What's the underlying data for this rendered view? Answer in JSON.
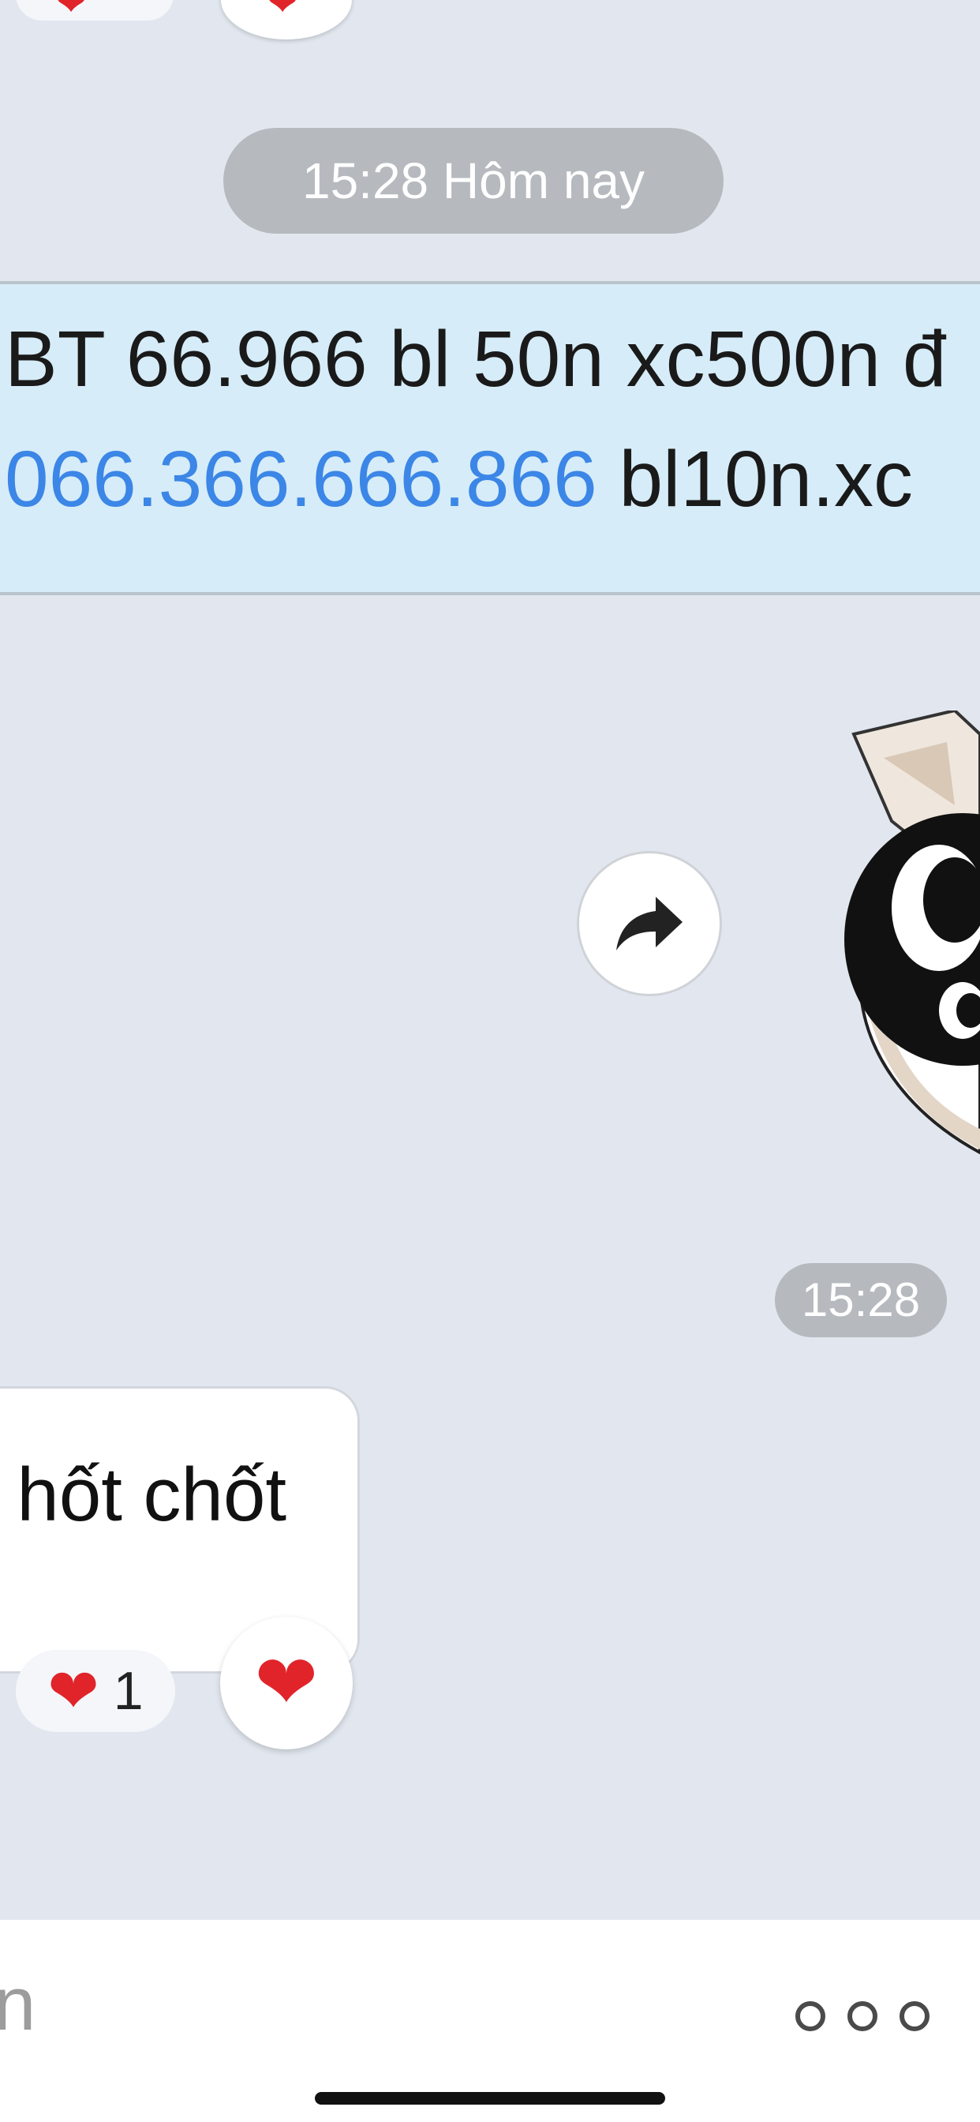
{
  "date_separator": "15:28 Hôm nay",
  "notice": {
    "line1_text": "BT 66.966 bl 50n xc500n đ",
    "line2_link": "066.366.666.866",
    "line2_text": " bl10n.xc"
  },
  "sticker_time": "15:28",
  "message": {
    "text": "hốt chốt"
  },
  "reactions": {
    "top_heart": "❤",
    "heart": "❤",
    "count": "1",
    "react_button": "❤"
  },
  "input": {
    "placeholder": "n"
  },
  "icons": {
    "share": "share-arrow-icon",
    "more": "more-dots-icon"
  },
  "colors": {
    "background": "#e2e7ef",
    "link": "#3b86e6",
    "heart": "#e0242a",
    "notice_bg": "#d6ecf8"
  }
}
